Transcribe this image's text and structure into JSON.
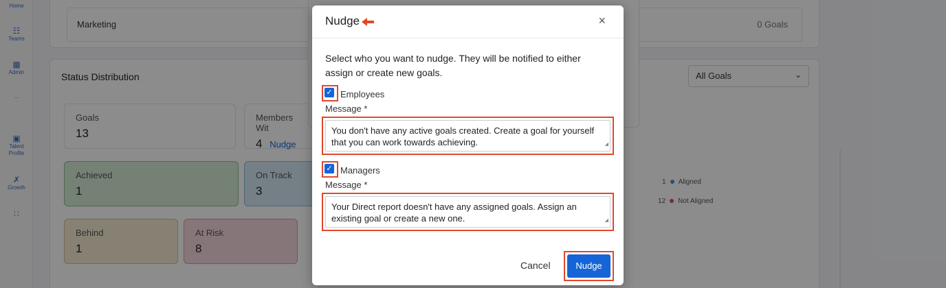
{
  "sidebar": {
    "items": [
      {
        "label": "Home",
        "icon": "home-icon"
      },
      {
        "label": "Teams",
        "icon": "teams-icon"
      },
      {
        "label": "Admin",
        "icon": "admin-icon"
      },
      {
        "label": "...",
        "icon": "more-icon"
      },
      {
        "label": "Talent Profile",
        "icon": "talent-profile-icon"
      },
      {
        "label": "Growth",
        "icon": "growth-icon"
      },
      {
        "label": "",
        "icon": "apps-grid-icon"
      }
    ]
  },
  "background": {
    "team_row": {
      "name": "Marketing",
      "goals": "0 Goals"
    },
    "status_title": "Status Distribution",
    "filter_select": "All Goals",
    "stats": {
      "goals": {
        "label": "Goals",
        "value": "13"
      },
      "members": {
        "label": "Members Wit",
        "value": "4",
        "link": "Nudge"
      },
      "achieved": {
        "label": "Achieved",
        "value": "1"
      },
      "on_track": {
        "label": "On Track",
        "value": "3"
      },
      "behind": {
        "label": "Behind",
        "value": "1"
      },
      "at_risk": {
        "label": "At Risk",
        "value": "8"
      }
    },
    "legend": [
      {
        "count": "1",
        "label": "Aligned",
        "color": "#4a90d9"
      },
      {
        "count": "12",
        "label": "Not Aligned",
        "color": "#d9534f"
      }
    ]
  },
  "modal": {
    "title": "Nudge",
    "close_symbol": "×",
    "description": "Select who you want to nudge. They will be notified to either assign or create new goals.",
    "employees": {
      "checked": true,
      "label": "Employees",
      "message_label": "Message *",
      "message": "You don't have any active goals created. Create a goal for yourself that you can work towards achieving."
    },
    "managers": {
      "checked": true,
      "label": "Managers",
      "message_label": "Message *",
      "message": "Your Direct report doesn't have any assigned goals. Assign an existing goal or create a new one."
    },
    "cancel_label": "Cancel",
    "nudge_label": "Nudge"
  },
  "colors": {
    "primary": "#1565d8",
    "highlight": "#e0482b",
    "achieved_bg": "#d5ecd4",
    "on_track_bg": "#d4e8f5",
    "behind_bg": "#f5ecd2",
    "at_risk_bg": "#f6d8dc"
  }
}
